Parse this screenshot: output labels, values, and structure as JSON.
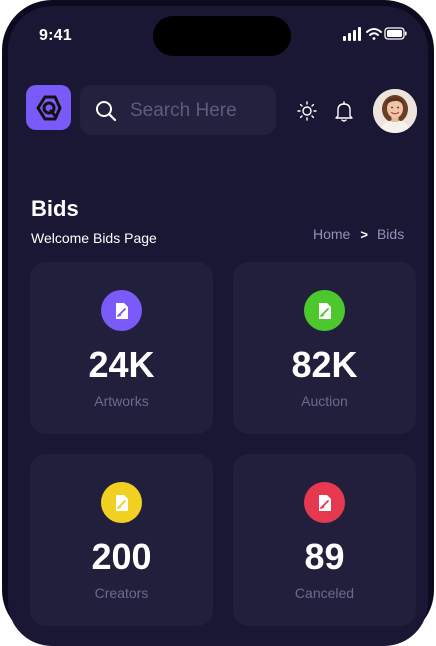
{
  "status_bar": {
    "time": "9:41"
  },
  "header": {
    "search_placeholder": "Search Here"
  },
  "page": {
    "title": "Bids",
    "subtitle": "Welcome Bids Page",
    "breadcrumb": {
      "home": "Home",
      "separator": ">",
      "current": "Bids"
    }
  },
  "stats": [
    {
      "value": "24K",
      "label": "Artworks",
      "color": "#7a5af8",
      "icon": "edit-document-icon"
    },
    {
      "value": "82K",
      "label": "Auction",
      "color": "#4cc72c",
      "icon": "edit-document-icon"
    },
    {
      "value": "200",
      "label": "Creators",
      "color": "#f2d022",
      "icon": "edit-document-icon"
    },
    {
      "value": "89",
      "label": "Canceled",
      "color": "#e63950",
      "icon": "edit-document-icon"
    }
  ],
  "colors": {
    "background": "#1a1735",
    "card": "#221f3d",
    "accent": "#7a5af8"
  }
}
